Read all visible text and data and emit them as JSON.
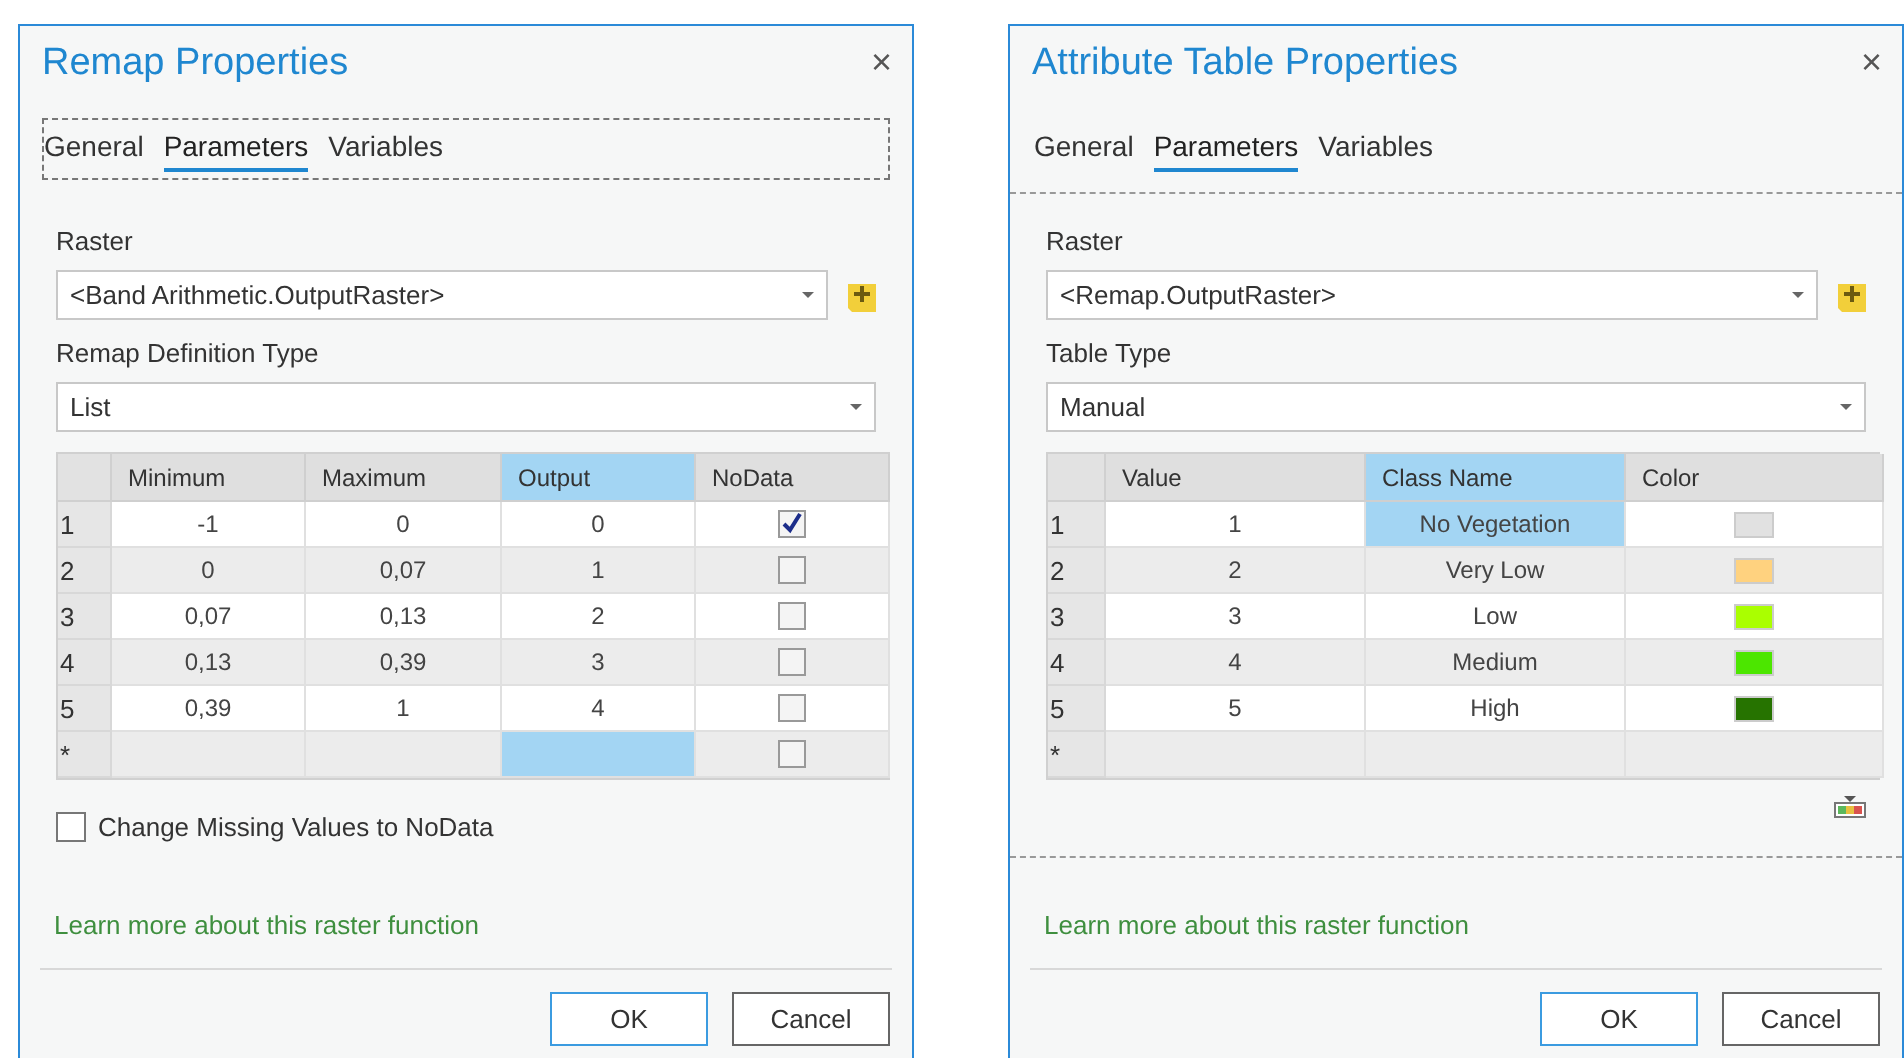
{
  "dialogs": [
    {
      "kind": "remap",
      "title": "Remap Properties",
      "close": "×",
      "tabs_focused": true,
      "tabs": [
        {
          "label": "General",
          "selected": false
        },
        {
          "label": "Parameters",
          "selected": true
        },
        {
          "label": "Variables",
          "selected": false
        }
      ],
      "fields": [
        {
          "label": "Raster",
          "value": "<Band Arithmetic.OutputRaster>",
          "add_button": true
        },
        {
          "label": "Remap Definition Type",
          "value": "List",
          "add_button": false
        }
      ],
      "table": {
        "columns": [
          {
            "label": "Minimum",
            "selected": false
          },
          {
            "label": "Maximum",
            "selected": false
          },
          {
            "label": "Output",
            "selected": true
          },
          {
            "label": "NoData",
            "selected": false
          }
        ],
        "rows": [
          {
            "number": "1",
            "cells": [
              {
                "kind": "text",
                "text": "-1",
                "selected": false
              },
              {
                "kind": "text",
                "text": "0",
                "selected": false
              },
              {
                "kind": "text",
                "text": "0",
                "selected": false
              },
              {
                "kind": "checkbox",
                "checked": true
              }
            ]
          },
          {
            "number": "2",
            "cells": [
              {
                "kind": "text",
                "text": "0",
                "selected": false
              },
              {
                "kind": "text",
                "text": "0,07",
                "selected": false
              },
              {
                "kind": "text",
                "text": "1",
                "selected": false
              },
              {
                "kind": "checkbox",
                "checked": false
              }
            ]
          },
          {
            "number": "3",
            "cells": [
              {
                "kind": "text",
                "text": "0,07",
                "selected": false
              },
              {
                "kind": "text",
                "text": "0,13",
                "selected": false
              },
              {
                "kind": "text",
                "text": "2",
                "selected": false
              },
              {
                "kind": "checkbox",
                "checked": false
              }
            ]
          },
          {
            "number": "4",
            "cells": [
              {
                "kind": "text",
                "text": "0,13",
                "selected": false
              },
              {
                "kind": "text",
                "text": "0,39",
                "selected": false
              },
              {
                "kind": "text",
                "text": "3",
                "selected": false
              },
              {
                "kind": "checkbox",
                "checked": false
              }
            ]
          },
          {
            "number": "5",
            "cells": [
              {
                "kind": "text",
                "text": "0,39",
                "selected": false
              },
              {
                "kind": "text",
                "text": "1",
                "selected": false
              },
              {
                "kind": "text",
                "text": "4",
                "selected": false
              },
              {
                "kind": "checkbox",
                "checked": false
              }
            ]
          },
          {
            "number": "*",
            "cells": [
              {
                "kind": "empty",
                "selected": false
              },
              {
                "kind": "empty",
                "selected": false
              },
              {
                "kind": "empty",
                "selected": true
              },
              {
                "kind": "checkbox",
                "checked": false
              }
            ]
          }
        ]
      },
      "option": {
        "label": "Change Missing Values to NoData",
        "checked": false
      },
      "link": "Learn more about this raster function",
      "buttons": [
        {
          "label": "OK",
          "default": true
        },
        {
          "label": "Cancel",
          "default": false
        }
      ]
    },
    {
      "kind": "attribute_table",
      "title": "Attribute Table Properties",
      "close": "×",
      "tabs_focused": false,
      "tabs": [
        {
          "label": "General",
          "selected": false
        },
        {
          "label": "Parameters",
          "selected": true
        },
        {
          "label": "Variables",
          "selected": false
        }
      ],
      "fields": [
        {
          "label": "Raster",
          "value": "<Remap.OutputRaster>",
          "add_button": true
        },
        {
          "label": "Table Type",
          "value": "Manual",
          "add_button": false
        }
      ],
      "table": {
        "columns": [
          {
            "label": "Value",
            "selected": false
          },
          {
            "label": "Class Name",
            "selected": true
          },
          {
            "label": "Color",
            "selected": false
          }
        ],
        "rows": [
          {
            "number": "1",
            "cells": [
              {
                "kind": "text",
                "text": "1",
                "selected": false
              },
              {
                "kind": "text",
                "text": "No Vegetation",
                "selected": true
              },
              {
                "kind": "color",
                "color": "#e1e1e1"
              }
            ]
          },
          {
            "number": "2",
            "cells": [
              {
                "kind": "text",
                "text": "2",
                "selected": false
              },
              {
                "kind": "text",
                "text": "Very Low",
                "selected": false
              },
              {
                "kind": "color",
                "color": "#ffd27f"
              }
            ]
          },
          {
            "number": "3",
            "cells": [
              {
                "kind": "text",
                "text": "3",
                "selected": false
              },
              {
                "kind": "text",
                "text": "Low",
                "selected": false
              },
              {
                "kind": "color",
                "color": "#aaff00"
              }
            ]
          },
          {
            "number": "4",
            "cells": [
              {
                "kind": "text",
                "text": "4",
                "selected": false
              },
              {
                "kind": "text",
                "text": "Medium",
                "selected": false
              },
              {
                "kind": "color",
                "color": "#4ce600"
              }
            ]
          },
          {
            "number": "5",
            "cells": [
              {
                "kind": "text",
                "text": "5",
                "selected": false
              },
              {
                "kind": "text",
                "text": "High",
                "selected": false
              },
              {
                "kind": "color",
                "color": "#267300"
              }
            ]
          },
          {
            "number": "*",
            "cells": [
              {
                "kind": "empty",
                "selected": false
              },
              {
                "kind": "empty",
                "selected": false
              },
              {
                "kind": "empty",
                "selected": false
              }
            ]
          }
        ]
      },
      "link": "Learn more about this raster function",
      "buttons": [
        {
          "label": "OK",
          "default": true
        },
        {
          "label": "Cancel",
          "default": false
        }
      ]
    }
  ]
}
